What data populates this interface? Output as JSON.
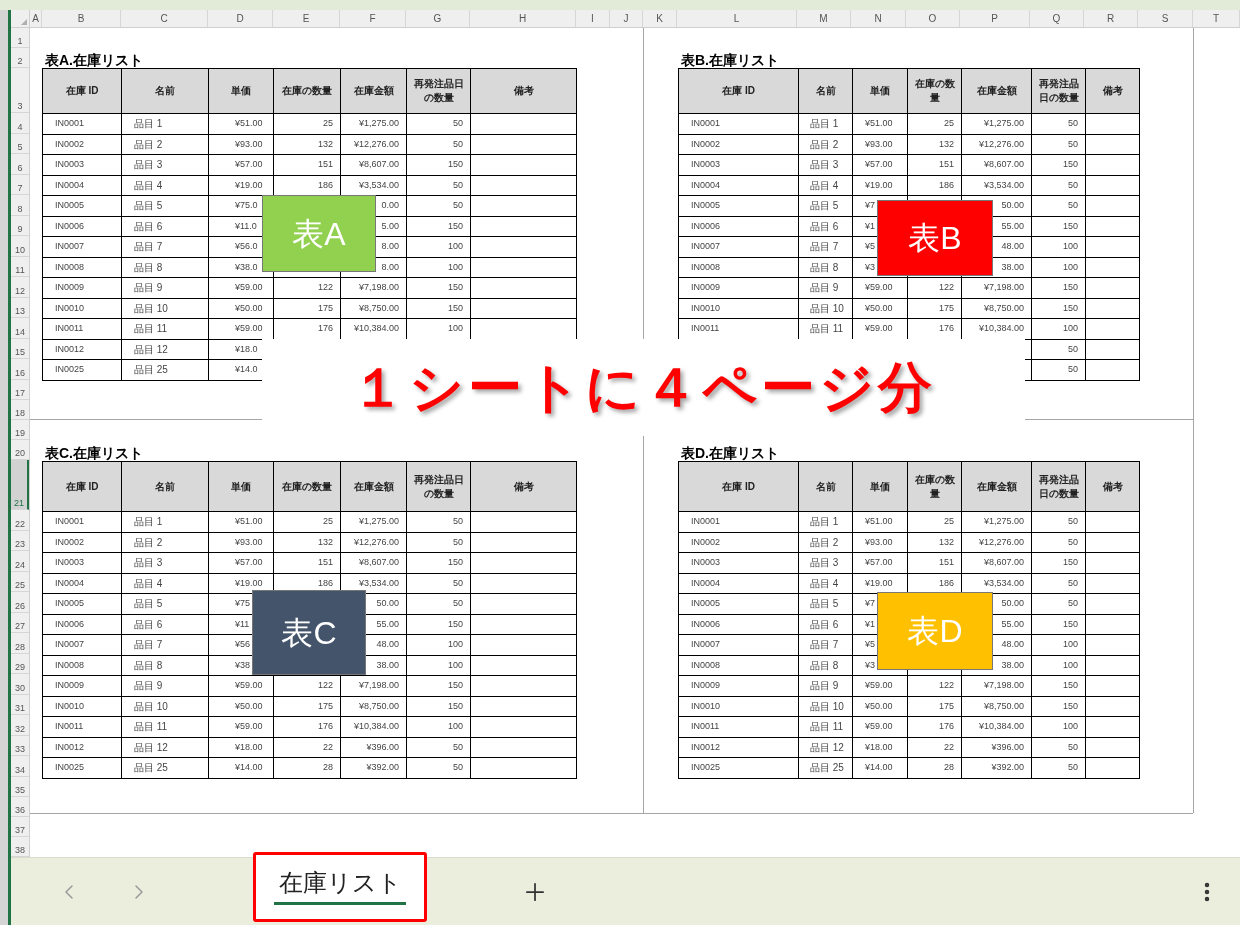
{
  "column_headers": [
    "A",
    "B",
    "C",
    "D",
    "E",
    "F",
    "G",
    "H",
    "I",
    "J",
    "K",
    "L",
    "M",
    "N",
    "O",
    "P",
    "Q",
    "R",
    "S",
    "T"
  ],
  "row_headers": [
    {
      "label": "1",
      "selected": false
    },
    {
      "label": "2",
      "selected": false
    },
    {
      "label": "3",
      "selected": false
    },
    {
      "label": "4",
      "selected": false
    },
    {
      "label": "5",
      "selected": false
    },
    {
      "label": "6",
      "selected": false
    },
    {
      "label": "7",
      "selected": false
    },
    {
      "label": "8",
      "selected": false
    },
    {
      "label": "9",
      "selected": false
    },
    {
      "label": "10",
      "selected": false
    },
    {
      "label": "11",
      "selected": false
    },
    {
      "label": "12",
      "selected": false
    },
    {
      "label": "13",
      "selected": false
    },
    {
      "label": "14",
      "selected": false
    },
    {
      "label": "15",
      "selected": false
    },
    {
      "label": "16",
      "selected": false
    },
    {
      "label": "17",
      "selected": false
    },
    {
      "label": "18",
      "selected": false
    },
    {
      "label": "19",
      "selected": false
    },
    {
      "label": "20",
      "selected": false
    },
    {
      "label": "21",
      "selected": true
    },
    {
      "label": "22",
      "selected": false
    },
    {
      "label": "23",
      "selected": false
    },
    {
      "label": "24",
      "selected": false
    },
    {
      "label": "25",
      "selected": false
    },
    {
      "label": "26",
      "selected": false
    },
    {
      "label": "27",
      "selected": false
    },
    {
      "label": "28",
      "selected": false
    },
    {
      "label": "29",
      "selected": false
    },
    {
      "label": "30",
      "selected": false
    },
    {
      "label": "31",
      "selected": false
    },
    {
      "label": "32",
      "selected": false
    },
    {
      "label": "33",
      "selected": false
    },
    {
      "label": "34",
      "selected": false
    },
    {
      "label": "35",
      "selected": false
    },
    {
      "label": "36",
      "selected": false
    },
    {
      "label": "37",
      "selected": false
    },
    {
      "label": "38",
      "selected": false
    }
  ],
  "pages": [
    {
      "title": "表A.在庫リスト",
      "columns": [
        "在庫 ID",
        "名前",
        "単価",
        "在庫の数量",
        "在庫金額",
        "再発注品日の数量",
        "備考"
      ],
      "rows": [
        [
          "IN0001",
          "品目 1",
          "¥51.00",
          "25",
          "¥1,275.00",
          "50",
          null
        ],
        [
          "IN0002",
          "品目 2",
          "¥93.00",
          "132",
          "¥12,276.00",
          "50",
          null
        ],
        [
          "IN0003",
          "品目 3",
          "¥57.00",
          "151",
          "¥8,607.00",
          "150",
          null
        ],
        [
          "IN0004",
          "品目 4",
          "¥19.00",
          "186",
          "¥3,534.00",
          "50",
          null
        ],
        [
          "IN0005",
          "品目 5",
          "¥75.0",
          null,
          "0.00",
          "50",
          null
        ],
        [
          "IN0006",
          "品目 6",
          "¥11.0",
          null,
          "5.00",
          "150",
          null
        ],
        [
          "IN0007",
          "品目 7",
          "¥56.0",
          null,
          "8.00",
          "100",
          null
        ],
        [
          "IN0008",
          "品目 8",
          "¥38.0",
          null,
          "8.00",
          "100",
          null
        ],
        [
          "IN0009",
          "品目 9",
          "¥59.00",
          "122",
          "¥7,198.00",
          "150",
          null
        ],
        [
          "IN0010",
          "品目 10",
          "¥50.00",
          "175",
          "¥8,750.00",
          "150",
          null
        ],
        [
          "IN0011",
          "品目 11",
          "¥59.00",
          "176",
          "¥10,384.00",
          "100",
          null
        ],
        [
          "IN0012",
          "品目 12",
          "¥18.0",
          null,
          null,
          null,
          null
        ],
        [
          "IN0025",
          "品目 25",
          "¥14.0",
          null,
          null,
          null,
          null
        ]
      ]
    },
    {
      "title": "表B.在庫リスト",
      "columns": [
        "在庫 ID",
        "名前",
        "単価",
        "在庫の数量",
        "在庫金額",
        "再発注品日の数量",
        "備考"
      ],
      "rows": [
        [
          "IN0001",
          "品目 1",
          "¥51.00",
          "25",
          "¥1,275.00",
          "50",
          null
        ],
        [
          "IN0002",
          "品目 2",
          "¥93.00",
          "132",
          "¥12,276.00",
          "50",
          null
        ],
        [
          "IN0003",
          "品目 3",
          "¥57.00",
          "151",
          "¥8,607.00",
          "150",
          null
        ],
        [
          "IN0004",
          "品目 4",
          "¥19.00",
          "186",
          "¥3,534.00",
          "50",
          null
        ],
        [
          "IN0005",
          "品目 5",
          "¥7",
          null,
          "50.00",
          "50",
          null
        ],
        [
          "IN0006",
          "品目 6",
          "¥1",
          null,
          "55.00",
          "150",
          null
        ],
        [
          "IN0007",
          "品目 7",
          "¥5",
          null,
          "48.00",
          "100",
          null
        ],
        [
          "IN0008",
          "品目 8",
          "¥3",
          null,
          "38.00",
          "100",
          null
        ],
        [
          "IN0009",
          "品目 9",
          "¥59.00",
          "122",
          "¥7,198.00",
          "150",
          null
        ],
        [
          "IN0010",
          "品目 10",
          "¥50.00",
          "175",
          "¥8,750.00",
          "150",
          null
        ],
        [
          "IN0011",
          "品目 11",
          "¥59.00",
          "176",
          "¥10,384.00",
          "100",
          null
        ],
        [
          null,
          null,
          null,
          null,
          null,
          "50",
          null
        ],
        [
          null,
          null,
          null,
          null,
          null,
          "50",
          null
        ]
      ]
    },
    {
      "title": "表C.在庫リスト",
      "columns": [
        "在庫 ID",
        "名前",
        "単価",
        "在庫の数量",
        "在庫金額",
        "再発注品日の数量",
        "備考"
      ],
      "rows": [
        [
          "IN0001",
          "品目 1",
          "¥51.00",
          "25",
          "¥1,275.00",
          "50",
          null
        ],
        [
          "IN0002",
          "品目 2",
          "¥93.00",
          "132",
          "¥12,276.00",
          "50",
          null
        ],
        [
          "IN0003",
          "品目 3",
          "¥57.00",
          "151",
          "¥8,607.00",
          "150",
          null
        ],
        [
          "IN0004",
          "品目 4",
          "¥19.00",
          "186",
          "¥3,534.00",
          "50",
          null
        ],
        [
          "IN0005",
          "品目 5",
          "¥75",
          null,
          "50.00",
          "50",
          null
        ],
        [
          "IN0006",
          "品目 6",
          "¥11",
          null,
          "55.00",
          "150",
          null
        ],
        [
          "IN0007",
          "品目 7",
          "¥56",
          null,
          "48.00",
          "100",
          null
        ],
        [
          "IN0008",
          "品目 8",
          "¥38",
          null,
          "38.00",
          "100",
          null
        ],
        [
          "IN0009",
          "品目 9",
          "¥59.00",
          "122",
          "¥7,198.00",
          "150",
          null
        ],
        [
          "IN0010",
          "品目 10",
          "¥50.00",
          "175",
          "¥8,750.00",
          "150",
          null
        ],
        [
          "IN0011",
          "品目 11",
          "¥59.00",
          "176",
          "¥10,384.00",
          "100",
          null
        ],
        [
          "IN0012",
          "品目 12",
          "¥18.00",
          "22",
          "¥396.00",
          "50",
          null
        ],
        [
          "IN0025",
          "品目 25",
          "¥14.00",
          "28",
          "¥392.00",
          "50",
          null
        ]
      ]
    },
    {
      "title": "表D.在庫リスト",
      "columns": [
        "在庫 ID",
        "名前",
        "単価",
        "在庫の数量",
        "在庫金額",
        "再発注品日の数量",
        "備考"
      ],
      "rows": [
        [
          "IN0001",
          "品目 1",
          "¥51.00",
          "25",
          "¥1,275.00",
          "50",
          null
        ],
        [
          "IN0002",
          "品目 2",
          "¥93.00",
          "132",
          "¥12,276.00",
          "50",
          null
        ],
        [
          "IN0003",
          "品目 3",
          "¥57.00",
          "151",
          "¥8,607.00",
          "150",
          null
        ],
        [
          "IN0004",
          "品目 4",
          "¥19.00",
          "186",
          "¥3,534.00",
          "50",
          null
        ],
        [
          "IN0005",
          "品目 5",
          "¥7",
          null,
          "50.00",
          "50",
          null
        ],
        [
          "IN0006",
          "品目 6",
          "¥1",
          null,
          "55.00",
          "150",
          null
        ],
        [
          "IN0007",
          "品目 7",
          "¥5",
          null,
          "48.00",
          "100",
          null
        ],
        [
          "IN0008",
          "品目 8",
          "¥3",
          null,
          "38.00",
          "100",
          null
        ],
        [
          "IN0009",
          "品目 9",
          "¥59.00",
          "122",
          "¥7,198.00",
          "150",
          null
        ],
        [
          "IN0010",
          "品目 10",
          "¥50.00",
          "175",
          "¥8,750.00",
          "150",
          null
        ],
        [
          "IN0011",
          "品目 11",
          "¥59.00",
          "176",
          "¥10,384.00",
          "100",
          null
        ],
        [
          "IN0012",
          "品目 12",
          "¥18.00",
          "22",
          "¥396.00",
          "50",
          null
        ],
        [
          "IN0025",
          "品目 25",
          "¥14.00",
          "28",
          "¥392.00",
          "50",
          null
        ]
      ]
    }
  ],
  "labels": [
    {
      "text": "表A",
      "color": "#92d050"
    },
    {
      "text": "表B",
      "color": "#ff0000"
    },
    {
      "text": "表C",
      "color": "#44546a"
    },
    {
      "text": "表D",
      "color": "#ffc000"
    }
  ],
  "banner": "１シートに４ページ分",
  "sheet_tabs": [
    {
      "label": "在庫リスト",
      "selected": true
    }
  ]
}
